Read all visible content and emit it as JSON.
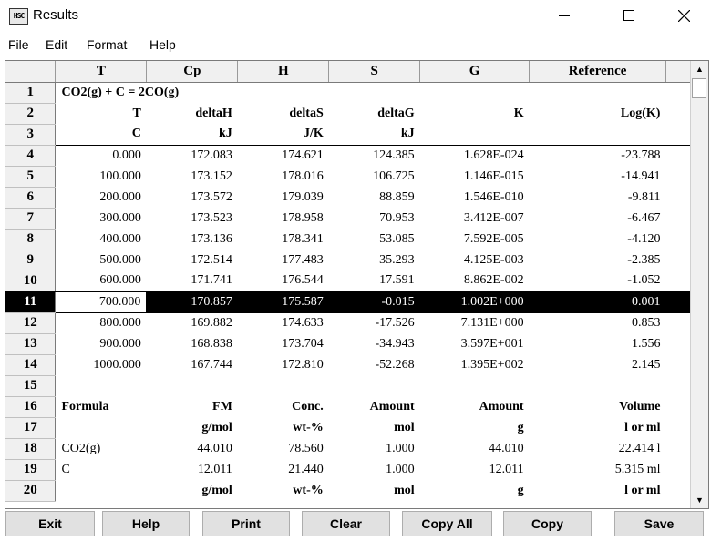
{
  "window": {
    "title": "Results",
    "icon_text": "HSC"
  },
  "menu": [
    "File",
    "Edit",
    "Format",
    "Help"
  ],
  "grid": {
    "columns": [
      "T",
      "Cp",
      "H",
      "S",
      "G",
      "Reference"
    ],
    "rows": [
      {
        "n": "1",
        "type": "span",
        "text": "CO2(g) + C = 2CO(g)"
      },
      {
        "n": "2",
        "type": "bold",
        "cells": [
          "T",
          "deltaH",
          "deltaS",
          "deltaG",
          "K",
          "Log(K)"
        ]
      },
      {
        "n": "3",
        "type": "bold",
        "cells": [
          "C",
          "kJ",
          "J/K",
          "kJ",
          "",
          ""
        ]
      },
      {
        "n": "4",
        "cells": [
          "0.000",
          "172.083",
          "174.621",
          "124.385",
          "1.628E-024",
          "-23.788"
        ]
      },
      {
        "n": "5",
        "cells": [
          "100.000",
          "173.152",
          "178.016",
          "106.725",
          "1.146E-015",
          "-14.941"
        ]
      },
      {
        "n": "6",
        "cells": [
          "200.000",
          "173.572",
          "179.039",
          "88.859",
          "1.546E-010",
          "-9.811"
        ]
      },
      {
        "n": "7",
        "cells": [
          "300.000",
          "173.523",
          "178.958",
          "70.953",
          "3.412E-007",
          "-6.467"
        ]
      },
      {
        "n": "8",
        "cells": [
          "400.000",
          "173.136",
          "178.341",
          "53.085",
          "7.592E-005",
          "-4.120"
        ]
      },
      {
        "n": "9",
        "cells": [
          "500.000",
          "172.514",
          "177.483",
          "35.293",
          "4.125E-003",
          "-2.385"
        ]
      },
      {
        "n": "10",
        "cells": [
          "600.000",
          "171.741",
          "176.544",
          "17.591",
          "8.862E-002",
          "-1.052"
        ]
      },
      {
        "n": "11",
        "cells": [
          "700.000",
          "170.857",
          "175.587",
          "-0.015",
          "1.002E+000",
          "0.001"
        ],
        "selected": true
      },
      {
        "n": "12",
        "cells": [
          "800.000",
          "169.882",
          "174.633",
          "-17.526",
          "7.131E+000",
          "0.853"
        ]
      },
      {
        "n": "13",
        "cells": [
          "900.000",
          "168.838",
          "173.704",
          "-34.943",
          "3.597E+001",
          "1.556"
        ]
      },
      {
        "n": "14",
        "cells": [
          "1000.000",
          "167.744",
          "172.810",
          "-52.268",
          "1.395E+002",
          "2.145"
        ]
      },
      {
        "n": "15",
        "cells": [
          "",
          "",
          "",
          "",
          "",
          ""
        ]
      },
      {
        "n": "16",
        "type": "bold",
        "cells": [
          "Formula",
          "FM",
          "Conc.",
          "Amount",
          "Amount",
          "Volume"
        ],
        "first_left": true
      },
      {
        "n": "17",
        "type": "bold",
        "cells": [
          "",
          "g/mol",
          "wt-%",
          "mol",
          "g",
          "l or ml"
        ]
      },
      {
        "n": "18",
        "cells": [
          "CO2(g)",
          "44.010",
          "78.560",
          "1.000",
          "44.010",
          "22.414 l"
        ],
        "first_left": true
      },
      {
        "n": "19",
        "cells": [
          "C",
          "12.011",
          "21.440",
          "1.000",
          "12.011",
          "5.315  ml"
        ],
        "first_left": true
      },
      {
        "n": "20",
        "type": "bold",
        "cells": [
          "",
          "g/mol",
          "wt-%",
          "mol",
          "g",
          "l or ml"
        ]
      }
    ]
  },
  "buttons": [
    "Exit",
    "Help",
    "Print",
    "Clear",
    "Copy All",
    "Copy",
    "Save"
  ]
}
